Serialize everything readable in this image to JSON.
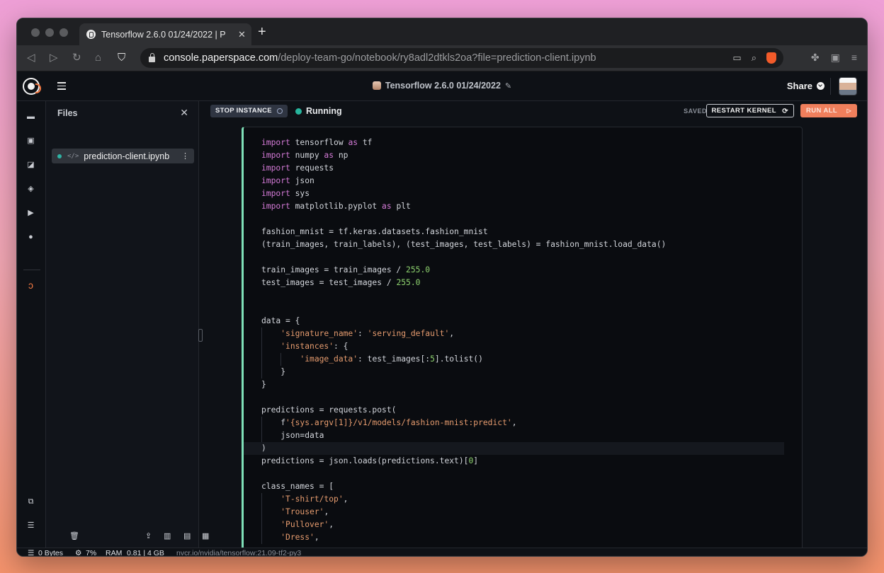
{
  "browser": {
    "tab_title": "Tensorflow 2.6.0 01/24/2022 | P",
    "tab_close": "✕",
    "new_tab": "+",
    "url_host": "console.paperspace.com",
    "url_path": "/deploy-team-go/notebook/ry8adl2dtkls2oa?file=prediction-client.ipynb",
    "nav": {
      "back": "◁",
      "forward": "▷",
      "reload": "↻",
      "home": "⌂",
      "bookmark": "⛉"
    }
  },
  "app": {
    "notebook_title": "Tensorflow 2.6.0 01/24/2022",
    "share_label": "Share",
    "files_title": "Files",
    "files_close": "✕",
    "file_name": "prediction-client.ipynb",
    "file_kebab": "⋮",
    "file_code_glyph": "</>",
    "toolbar": {
      "stop_label": "STOP INSTANCE",
      "status_label": "Running",
      "saved_label": "SAVED",
      "restart_label": "RESTART KERNEL",
      "run_all_label": "RUN ALL",
      "status_color": "#27b59d",
      "run_all_color": "#f07f5c"
    },
    "statusbar": {
      "storage": "0 Bytes",
      "cpu": "7%",
      "ram_label": "RAM",
      "ram_value": "0.81 | 4 GB",
      "image": "nvcr.io/nvidia/tensorflow:21.09-tf2-py3"
    },
    "rail_icons": [
      "folder-icon",
      "chip-icon",
      "chart-icon",
      "package-icon",
      "terminal-icon",
      "clock-icon",
      "jupyter-icon",
      "share-gallery-icon",
      "database-icon"
    ],
    "file_tool_icons": [
      "trash-icon",
      "upload-icon",
      "book-icon",
      "new-file-icon",
      "new-folder-icon"
    ]
  }
}
